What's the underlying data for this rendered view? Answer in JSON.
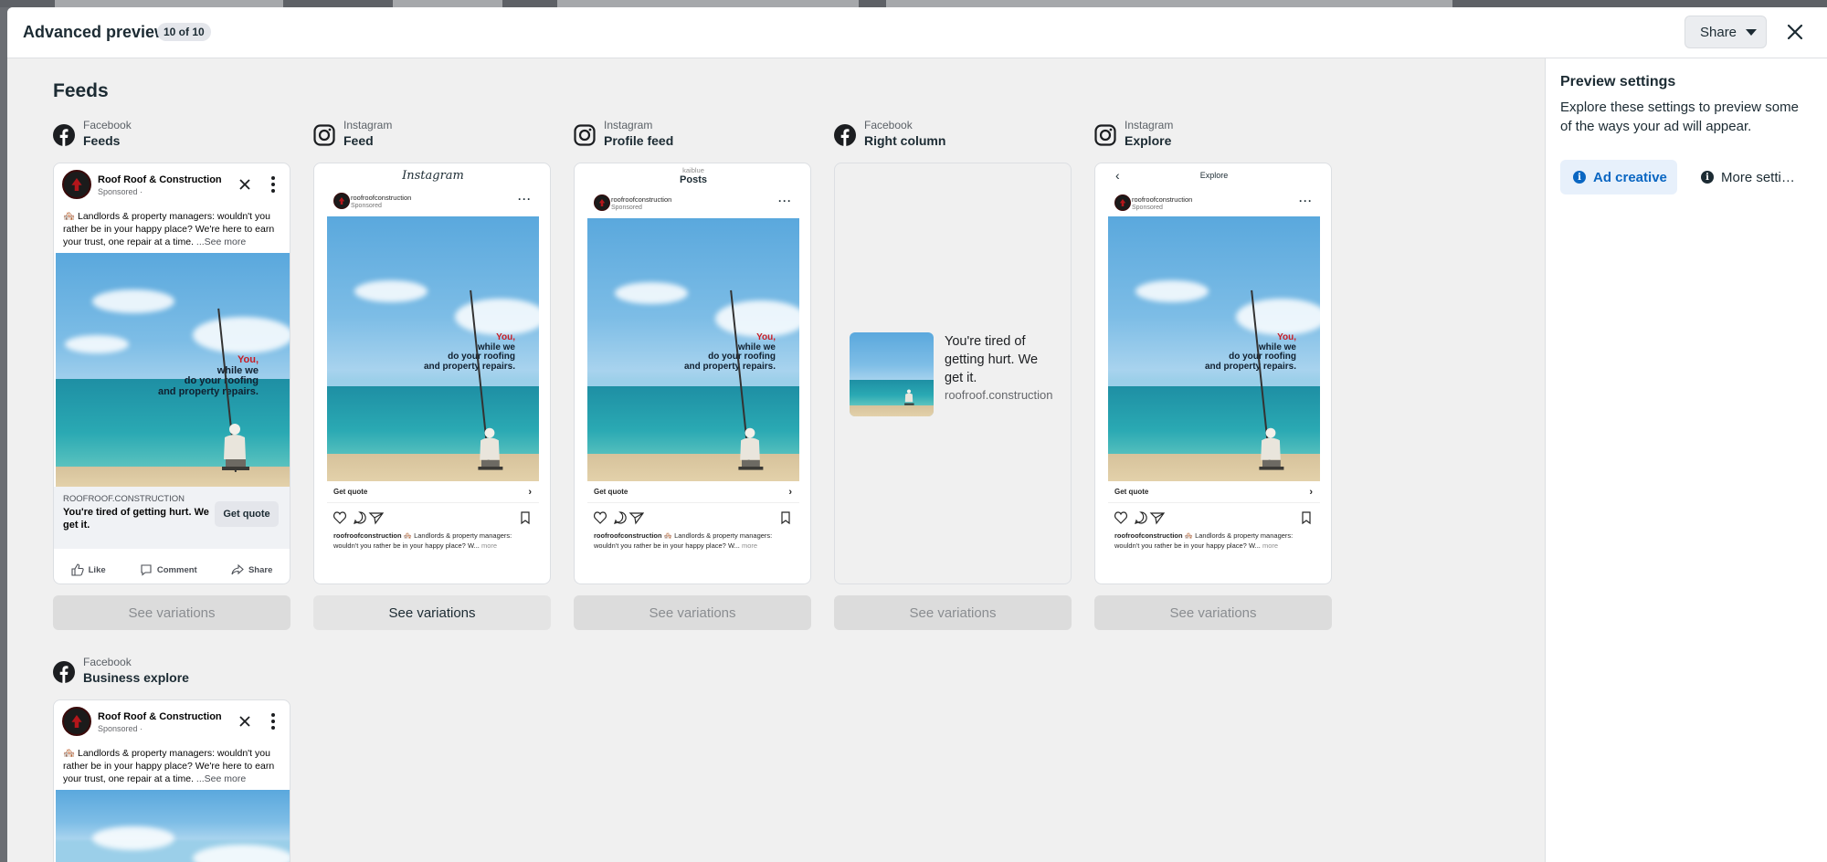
{
  "header": {
    "title": "Advanced preview",
    "count": "10 of 10",
    "share_label": "Share"
  },
  "main": {
    "section_title": "Feeds"
  },
  "settings": {
    "title": "Preview settings",
    "description": "Explore these settings to preview some of the ways your ad will appear.",
    "tabs": [
      {
        "label": "Ad creative",
        "active": true
      },
      {
        "label": "More setti…",
        "active": false
      }
    ]
  },
  "ad": {
    "page_name": "Roof Roof & Construction",
    "sponsored": "Sponsored ·",
    "primary_text": "🏘️ Landlords & property managers: wouldn't you rather be in your happy place? We're here to earn your trust, one repair at a time.",
    "see_more": "...See more",
    "domain_caps": "ROOFROOF.CONSTRUCTION",
    "headline": "You're tired of getting hurt. We get it.",
    "cta": "Get quote",
    "image_caption_red": "You,",
    "image_caption_lines": [
      "while we",
      "do your roofing",
      "and property repairs."
    ],
    "ig_handle": "roofroofconstruction",
    "ig_sponsored": "Sponsored",
    "ig_caption": "🏘️ Landlords & property managers: wouldn't you rather be in your happy place? W...",
    "ig_more": "more",
    "rc_domain": "roofroof.construction",
    "fb_actions": [
      "Like",
      "Comment",
      "Share"
    ]
  },
  "placements": [
    {
      "platform": "Facebook",
      "name": "Feeds",
      "see_variations": "See variations",
      "enabled": false
    },
    {
      "platform": "Instagram",
      "name": "Feed",
      "top_label": "Instagram",
      "see_variations": "See variations",
      "enabled": true
    },
    {
      "platform": "Instagram",
      "name": "Profile feed",
      "top_small": "kaiblue",
      "top_label": "Posts",
      "see_variations": "See variations",
      "enabled": false
    },
    {
      "platform": "Facebook",
      "name": "Right column",
      "see_variations": "See variations",
      "enabled": false
    },
    {
      "platform": "Instagram",
      "name": "Explore",
      "top_label": "Explore",
      "see_variations": "See variations",
      "enabled": false
    },
    {
      "platform": "Facebook",
      "name": "Business explore"
    }
  ],
  "colors": {
    "accent": "#0a66c2",
    "active_tab_bg": "#e7f0fb",
    "caption_red": "#c81d25"
  }
}
